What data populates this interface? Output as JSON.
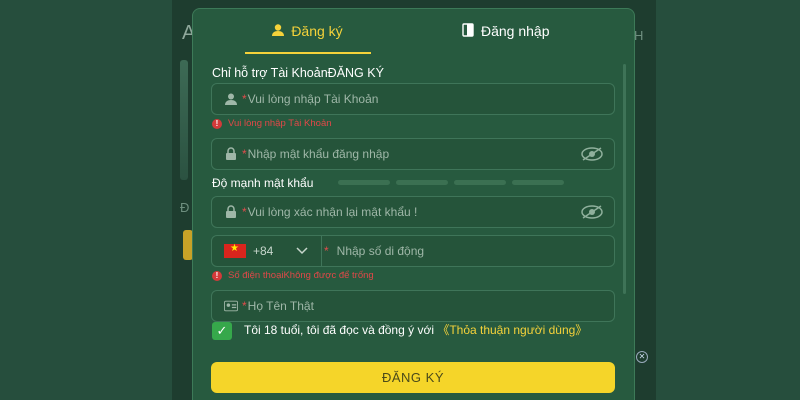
{
  "background": {
    "top_text": "...",
    "right_letter": "H",
    "left_letter": "Đ",
    "left_letter_a": "A"
  },
  "tabs": {
    "register_label": "Đăng ký",
    "login_label": "Đăng nhập"
  },
  "form": {
    "section_title": "Chỉ hỗ trợ Tài KhoảnĐĂNG KÝ",
    "username": {
      "required_mark": "*",
      "placeholder": "Vui lòng nhập Tài Khoản",
      "error": "Vui lòng nhập Tài Khoản"
    },
    "password": {
      "required_mark": "*",
      "placeholder": "Nhập mật khẩu đăng nhập"
    },
    "strength_label": "Độ mạnh mật khẩu",
    "confirm_password": {
      "required_mark": "*",
      "placeholder": "Vui lòng xác nhận lại mật khẩu !"
    },
    "phone": {
      "country_code": "+84",
      "required_mark": "*",
      "placeholder": "Nhập số di động",
      "error": "Số điện thoạiKhông được để trống"
    },
    "full_name": {
      "required_mark": "*",
      "placeholder": "Họ Tên Thật"
    },
    "agreement": {
      "text": "Tôi 18 tuổi, tôi đã đọc và đồng ý với ",
      "link": "《Thỏa thuận người dùng》",
      "checked": true
    },
    "submit_label": "ĐĂNG KÝ"
  },
  "colors": {
    "accent": "#f5d23a",
    "error": "#e04848",
    "modal_bg": "#275a3f"
  }
}
